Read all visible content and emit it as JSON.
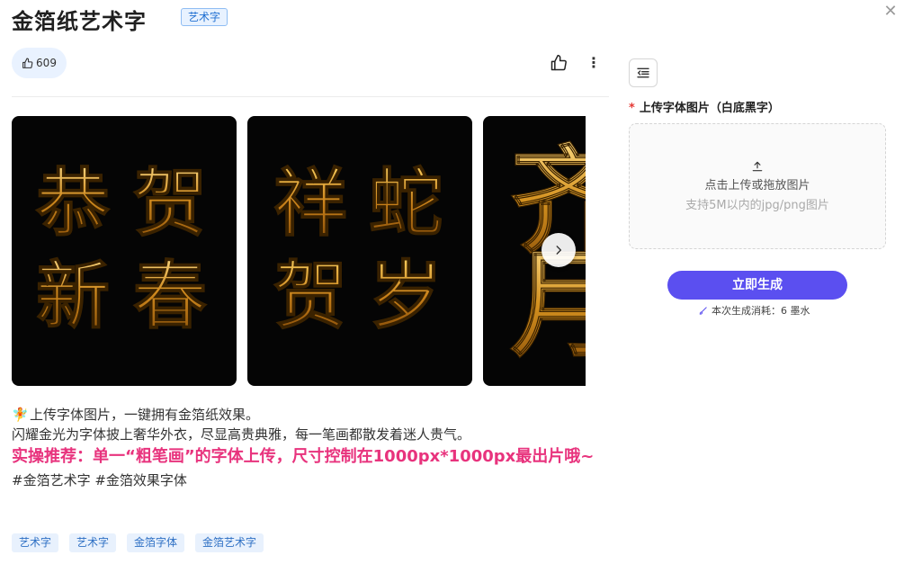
{
  "header": {
    "title": "金箔纸艺术字",
    "badge": "艺术字"
  },
  "stats": {
    "likes": "609"
  },
  "gallery": {
    "cards": [
      {
        "glyphs": [
          "恭",
          "贺",
          "新",
          "春"
        ]
      },
      {
        "glyphs": [
          "祥",
          "蛇",
          "贺",
          "岁"
        ]
      },
      {
        "glyphs": [
          "齐",
          "月"
        ]
      }
    ]
  },
  "description": {
    "emoji": "🧚",
    "line1": "上传字体图片，一键拥有金箔纸效果。",
    "line2": "闪耀金光为字体披上奢华外衣，尽显高贵典雅，每一笔画都散发着迷人贵气。",
    "highlight": "实操推荐：单一“粗笔画”的字体上传，尺寸控制在1000px*1000px最出片哦~",
    "hashtags": "#金箔艺术字 #金箔效果字体"
  },
  "tags": [
    "艺术字",
    "艺术字",
    "金箔字体",
    "金箔艺术字"
  ],
  "panel": {
    "upload_label": "上传字体图片（白底黑字）",
    "required_mark": "*",
    "upload_main": "点击上传或拖放图片",
    "upload_sub": "支持5M以内的jpg/png图片",
    "generate_label": "立即生成",
    "cost_text": "本次生成消耗：6 墨水"
  },
  "colors": {
    "accent": "#5b4ff0",
    "highlight": "#e8337d",
    "gold": "#d89a2a"
  }
}
